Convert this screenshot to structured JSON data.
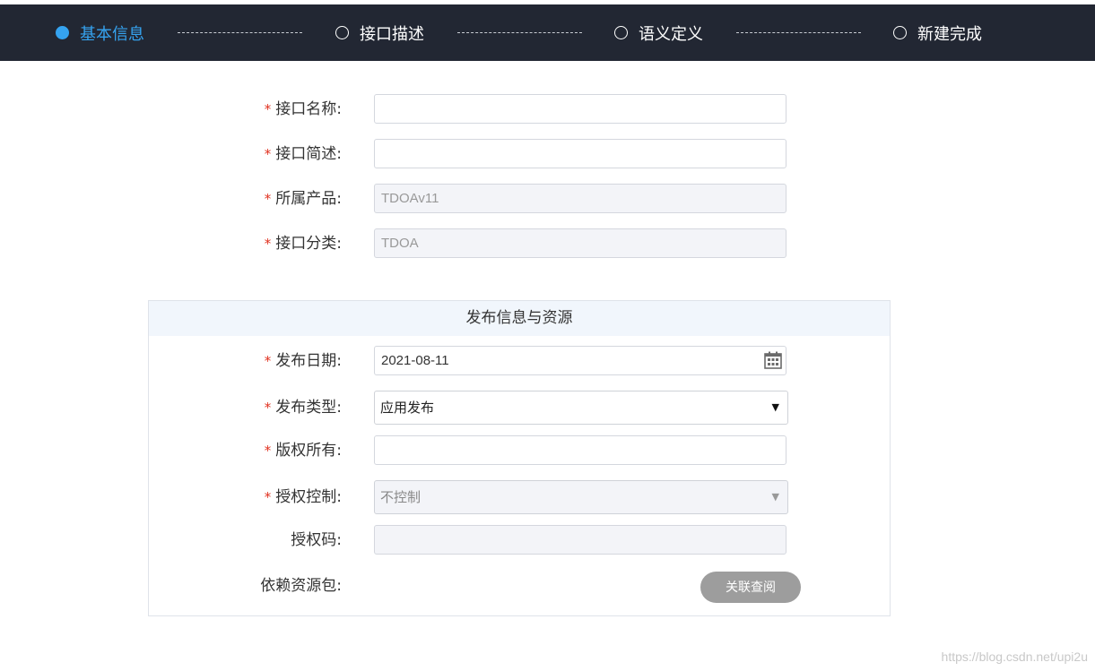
{
  "steps": [
    {
      "label": "基本信息",
      "active": true
    },
    {
      "label": "接口描述",
      "active": false
    },
    {
      "label": "语义定义",
      "active": false
    },
    {
      "label": "新建完成",
      "active": false
    }
  ],
  "basic": {
    "name": {
      "label": "接口名称:",
      "value": ""
    },
    "summary": {
      "label": "接口简述:",
      "value": ""
    },
    "product": {
      "label": "所属产品:",
      "value": "TDOAv11"
    },
    "category": {
      "label": "接口分类:",
      "value": "TDOA"
    }
  },
  "publish": {
    "title": "发布信息与资源",
    "date": {
      "label": "发布日期:",
      "value": "2021-08-11"
    },
    "type": {
      "label": "发布类型:",
      "value": "应用发布"
    },
    "copyright": {
      "label": "版权所有:",
      "value": ""
    },
    "auth_control": {
      "label": "授权控制:",
      "value": "不控制"
    },
    "auth_code": {
      "label": "授权码:",
      "value": ""
    },
    "dependency": {
      "label": "依赖资源包:",
      "button": "关联查阅"
    }
  },
  "required_mark": "*",
  "watermark": "https://blog.csdn.net/upi2u",
  "colors": {
    "accent": "#35a3f0",
    "header_bg": "#222733",
    "required": "#e0301e"
  }
}
